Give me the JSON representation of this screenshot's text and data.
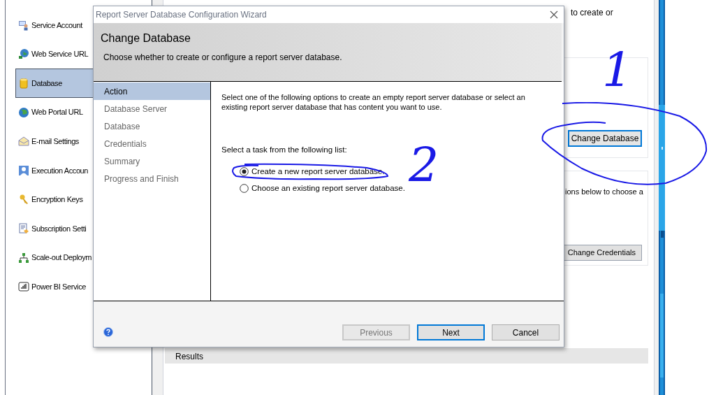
{
  "background_window": {
    "sidebar": {
      "items": [
        {
          "label": "Service Account",
          "selected": false
        },
        {
          "label": "Web Service URL",
          "selected": false
        },
        {
          "label": "Database",
          "selected": true
        },
        {
          "label": "Web Portal URL",
          "selected": false
        },
        {
          "label": "E-mail Settings",
          "selected": false
        },
        {
          "label": "Execution Accoun",
          "selected": false
        },
        {
          "label": "Encryption Keys",
          "selected": false
        },
        {
          "label": "Subscription Setti",
          "selected": false
        },
        {
          "label": "Scale-out Deploym",
          "selected": false
        },
        {
          "label": "Power BI Service",
          "selected": false
        }
      ]
    },
    "database_section": {
      "text": "to create or",
      "button": "Change Database"
    },
    "credentials_section": {
      "text": "ions below to choose a",
      "button": "Change Credentials"
    },
    "results_header": "Results"
  },
  "dialog": {
    "title": "Report Server Database Configuration Wizard",
    "header": {
      "title": "Change Database",
      "subtitle": "Choose whether to create or configure a report server database."
    },
    "steps": [
      {
        "label": "Action",
        "selected": true
      },
      {
        "label": "Database Server",
        "selected": false
      },
      {
        "label": "Database",
        "selected": false
      },
      {
        "label": "Credentials",
        "selected": false
      },
      {
        "label": "Summary",
        "selected": false
      },
      {
        "label": "Progress and Finish",
        "selected": false
      }
    ],
    "intro": "Select one of the following options to create an empty report server database or select an existing report server database that has content you want to use.",
    "task_label": "Select a task from the following list:",
    "options": [
      {
        "label": "Create a new report server database.",
        "selected": true
      },
      {
        "label": "Choose an existing report server database.",
        "selected": false
      }
    ],
    "buttons": [
      {
        "label": "Previous",
        "disabled": true,
        "default": false
      },
      {
        "label": "Next",
        "disabled": false,
        "default": true
      },
      {
        "label": "Cancel",
        "disabled": false,
        "default": false
      }
    ]
  },
  "annotations": [
    {
      "text": "1"
    },
    {
      "text": "2"
    }
  ]
}
